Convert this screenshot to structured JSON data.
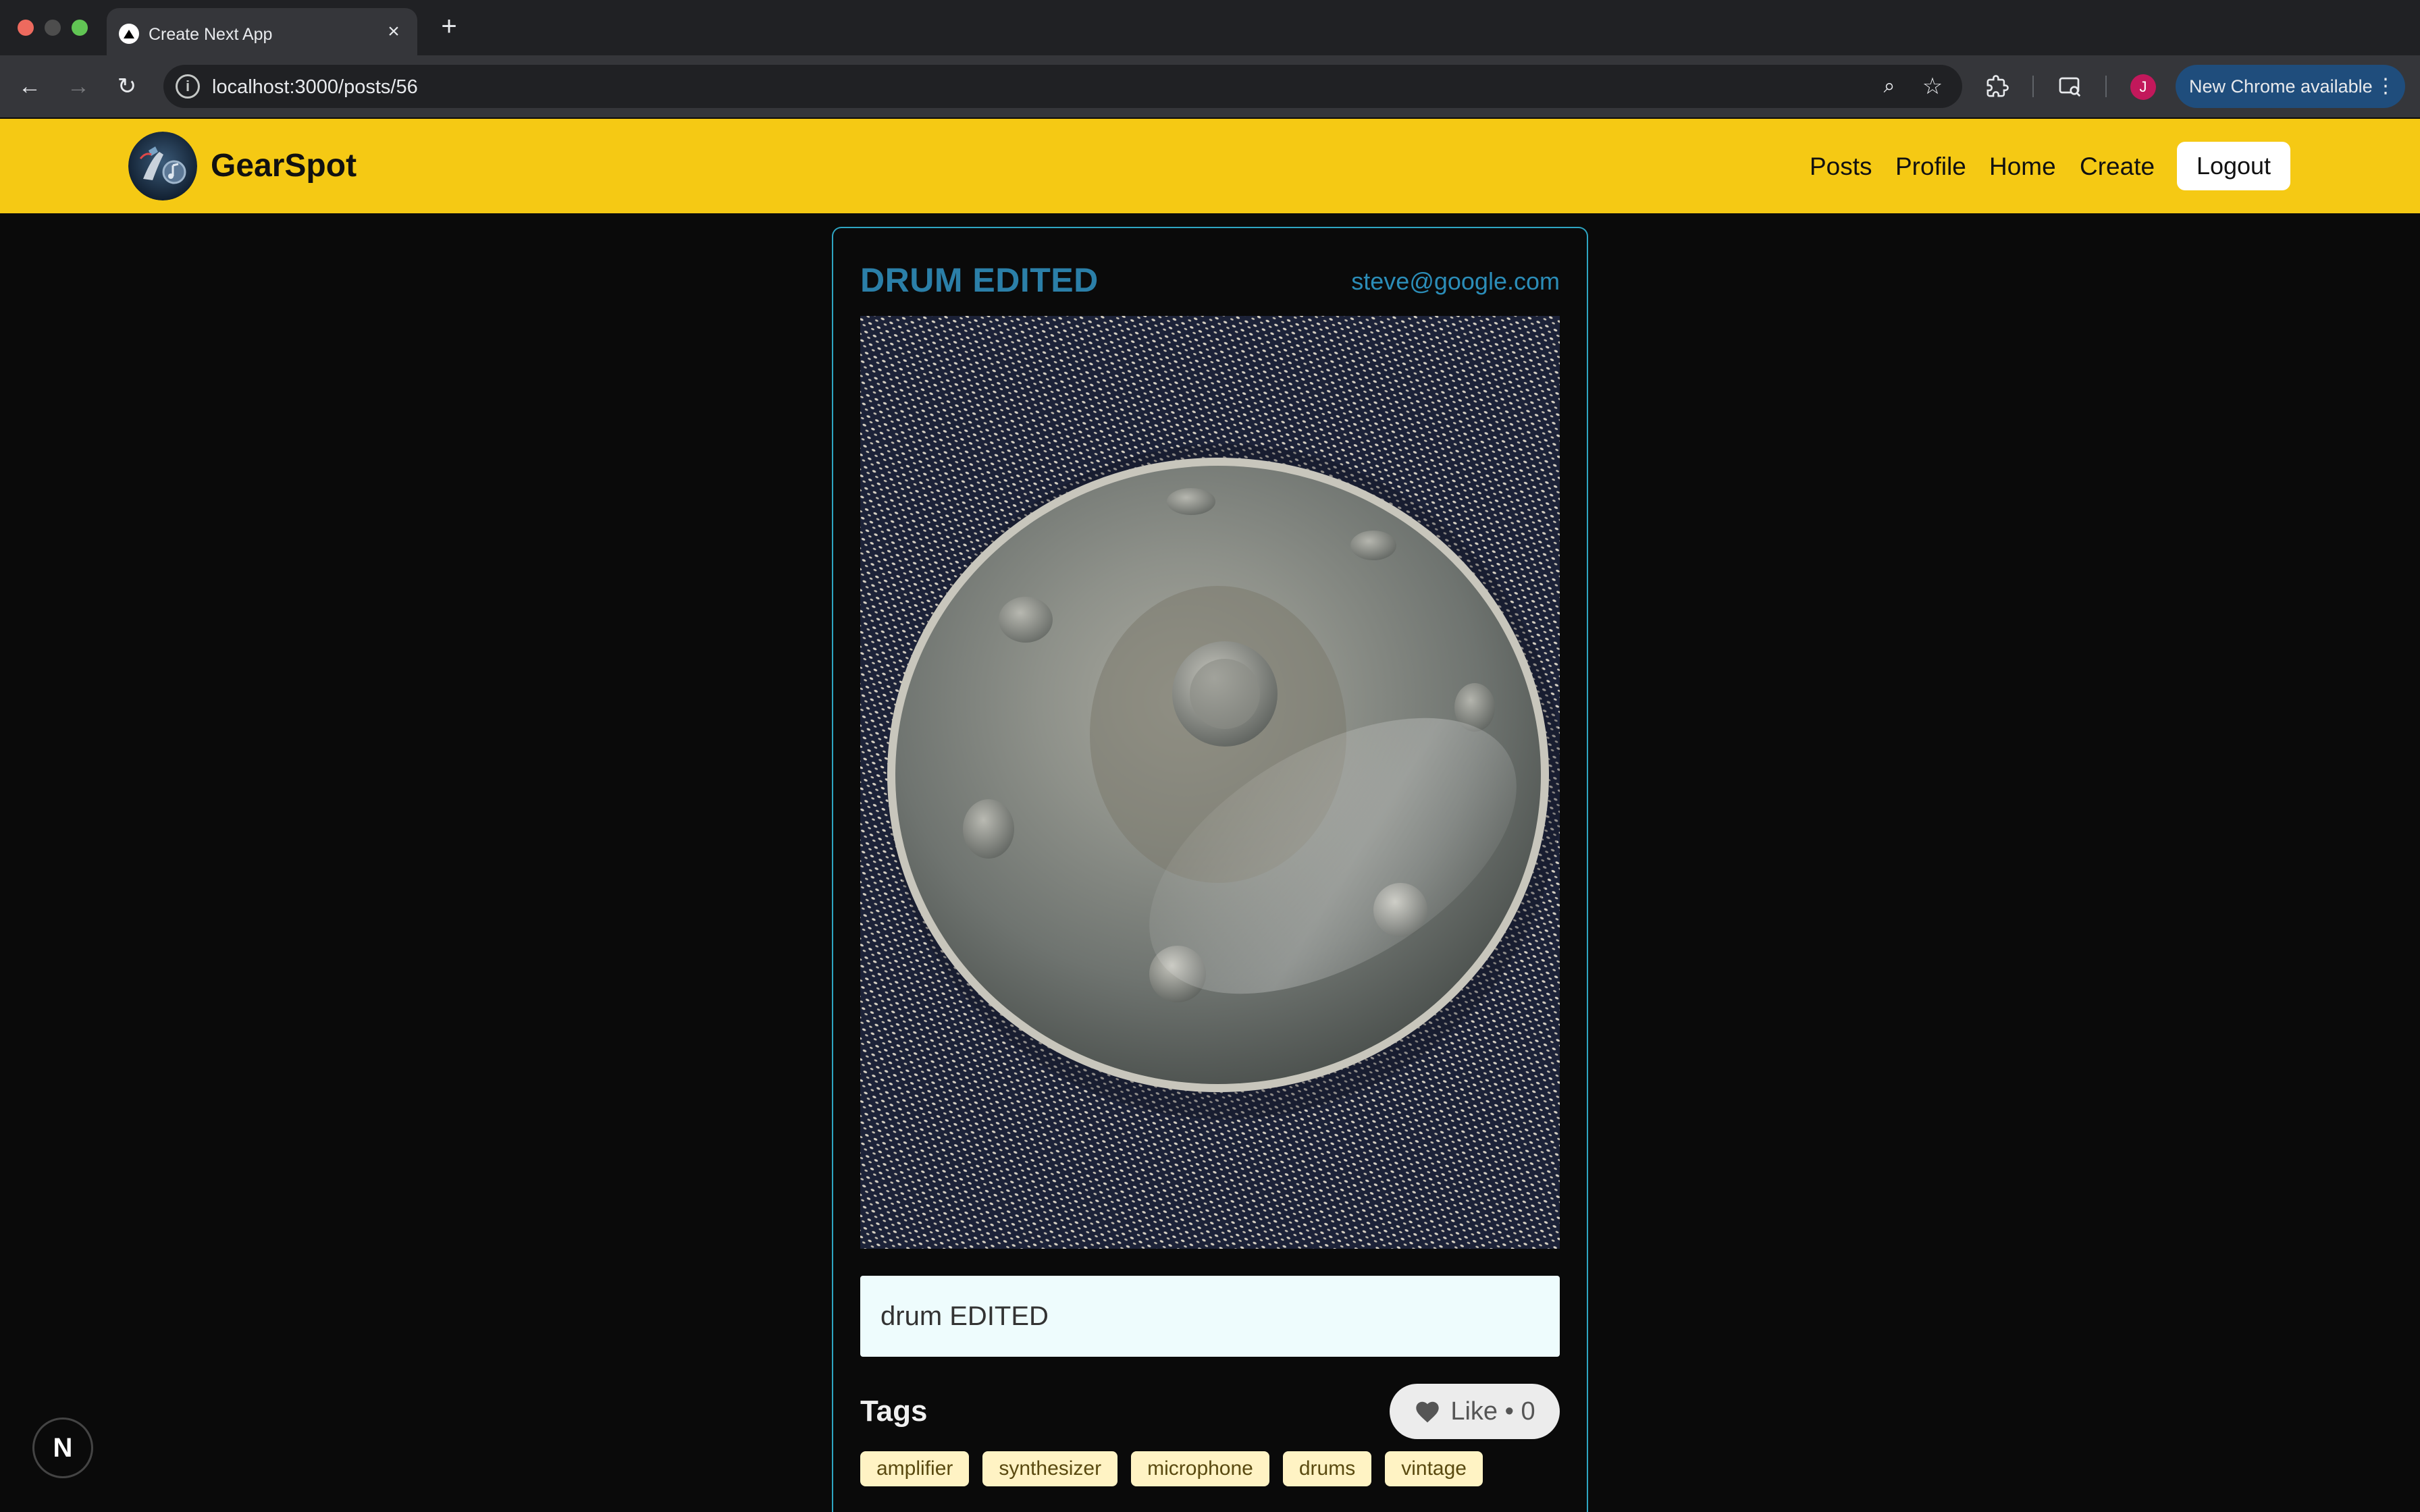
{
  "browser": {
    "tab_title": "Create Next App",
    "url": "localhost:3000/posts/56",
    "profile_initial": "J",
    "update_label": "New Chrome available"
  },
  "header": {
    "brand": "GearSpot",
    "nav": {
      "posts": "Posts",
      "profile": "Profile",
      "home": "Home",
      "create": "Create",
      "logout": "Logout"
    },
    "background": "#f5c914"
  },
  "post": {
    "title": "DRUM EDITED",
    "author": "steve@google.com",
    "caption": "drum EDITED",
    "tags_heading": "Tags",
    "like_label": "Like • 0",
    "tags": [
      "amplifier",
      "synthesizer",
      "microphone",
      "drums",
      "vintage"
    ],
    "accent": "#2b7fa8"
  },
  "icons": {
    "nextjs_badge": "N"
  }
}
